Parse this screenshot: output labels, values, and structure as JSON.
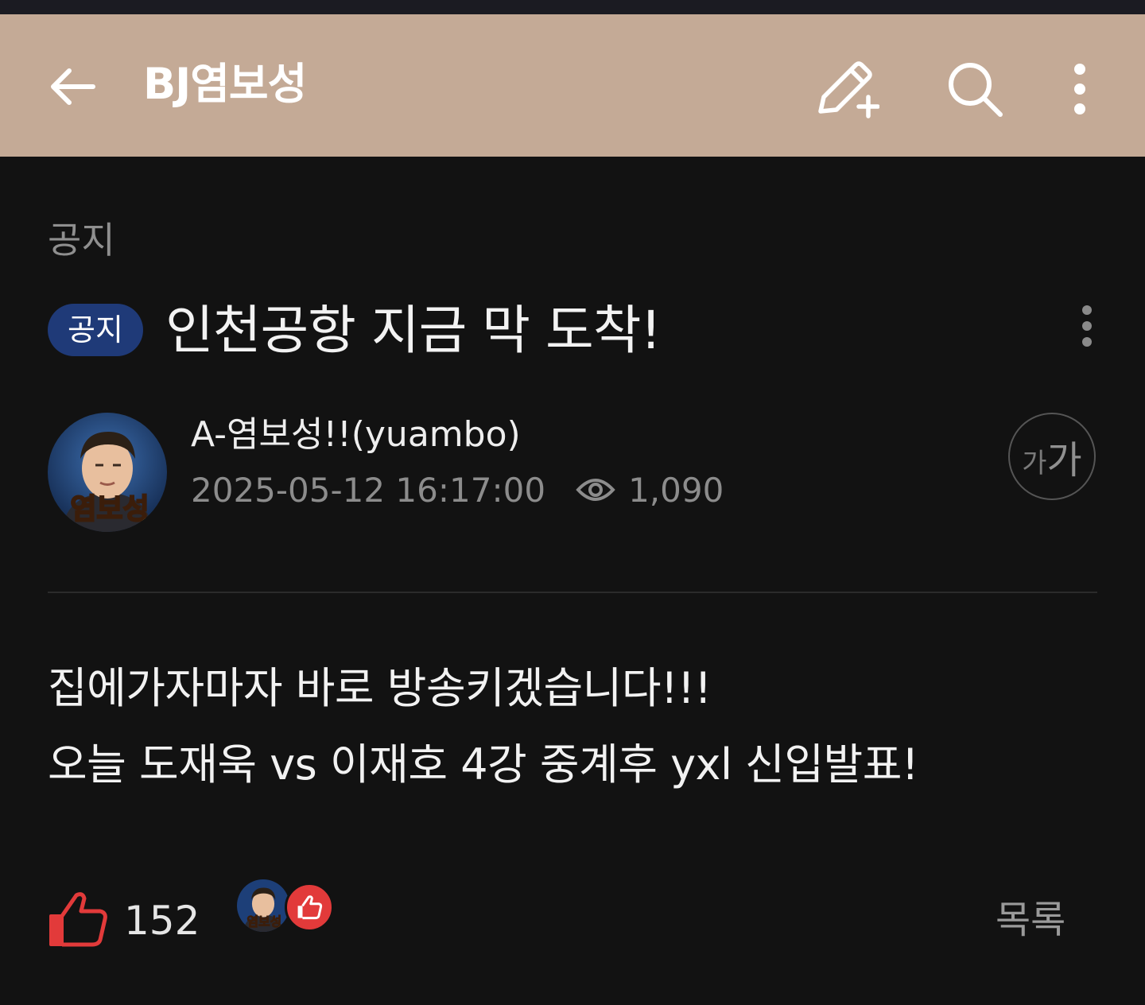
{
  "appbar": {
    "title": "BJ염보성",
    "back_icon": "arrow-left-icon",
    "write_icon": "pencil-plus-icon",
    "search_icon": "search-icon",
    "more_icon": "more-vertical-icon",
    "background": "#c4aa96"
  },
  "board": {
    "category": "공지"
  },
  "post": {
    "badge": "공지",
    "badge_color": "#1f3a78",
    "title": "인천공항 지금 막 도착!",
    "author": "A-염보성!!(yuambo)",
    "datetime": "2025-05-12 16:17:00",
    "views": "1,090",
    "font_toggle": {
      "small": "가",
      "large": "가"
    },
    "body": [
      "집에가자마자 바로 방송키겠습니다!!!",
      "오늘 도재욱 vs 이재호 4강 중계후 yxl 신입발표!"
    ],
    "avatar_caption": "염보성"
  },
  "footer": {
    "like_count": "152",
    "list_button": "목록",
    "like_color": "#e23a3a"
  }
}
